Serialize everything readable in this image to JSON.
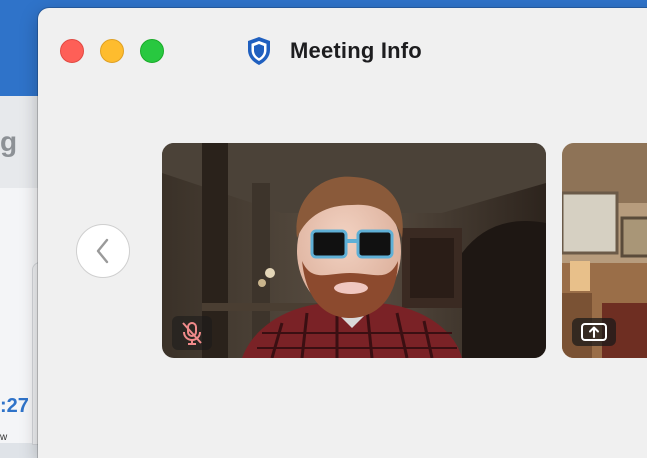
{
  "window": {
    "title": "Meeting Info",
    "title_icon": "shield-icon",
    "controls": [
      "close",
      "minimize",
      "zoom"
    ]
  },
  "background_app": {
    "partial_text": "g",
    "partial_time": ":27",
    "partial_tiny": "w"
  },
  "navigation": {
    "prev_icon": "chevron-left-icon"
  },
  "participants": [
    {
      "tile": "main",
      "status_icon": "mic-muted-icon",
      "status_color": "#f08a8a"
    },
    {
      "tile": "next",
      "status_icon": "screen-share-icon",
      "status_color": "#ffffff"
    }
  ],
  "colors": {
    "accent": "#1f5fbf",
    "close": "#fe5f57",
    "minimize": "#febc2e",
    "zoom": "#28c840",
    "window_bg": "#f0f0f0"
  }
}
